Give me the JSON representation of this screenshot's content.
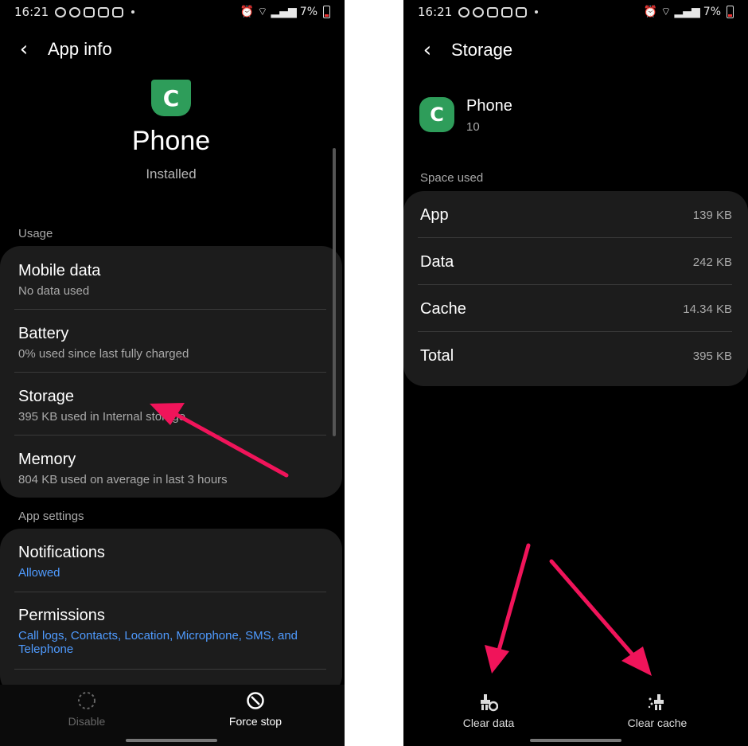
{
  "left": {
    "status": {
      "time": "16:21",
      "battery": "7%"
    },
    "header": {
      "title": "App info"
    },
    "app": {
      "name": "Phone",
      "state": "Installed"
    },
    "usage": {
      "label": "Usage",
      "items": [
        {
          "title": "Mobile data",
          "subtitle": "No data used"
        },
        {
          "title": "Battery",
          "subtitle": "0% used since last fully charged"
        },
        {
          "title": "Storage",
          "subtitle": "395 KB used in Internal storage"
        },
        {
          "title": "Memory",
          "subtitle": "804 KB used on average in last 3 hours"
        }
      ]
    },
    "app_settings": {
      "label": "App settings",
      "items": [
        {
          "title": "Notifications",
          "subtitle": "Allowed"
        },
        {
          "title": "Permissions",
          "subtitle": "Call logs, Contacts, Location, Microphone, SMS, and Telephone"
        }
      ]
    },
    "bottom": {
      "disable_label": "Disable",
      "force_stop_label": "Force stop"
    }
  },
  "right": {
    "status": {
      "time": "16:21",
      "battery": "7%"
    },
    "header": {
      "title": "Storage"
    },
    "app": {
      "name": "Phone",
      "version": "10"
    },
    "space_used": {
      "label": "Space used",
      "rows": [
        {
          "label": "App",
          "value": "139 KB"
        },
        {
          "label": "Data",
          "value": "242 KB"
        },
        {
          "label": "Cache",
          "value": "14.34 KB"
        },
        {
          "label": "Total",
          "value": "395 KB"
        }
      ]
    },
    "bottom": {
      "clear_data_label": "Clear data",
      "clear_cache_label": "Clear cache"
    }
  },
  "colors": {
    "accent_green": "#2e9d5a",
    "link_blue": "#4f9bff",
    "annotation_pink": "#f0145a"
  }
}
